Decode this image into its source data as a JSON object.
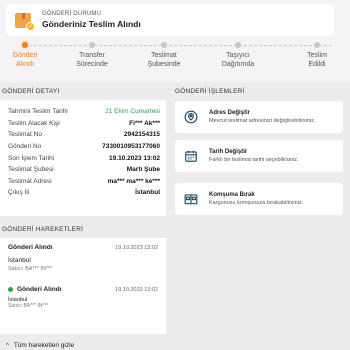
{
  "status": {
    "kicker": "GÖNDERİ DURUMU",
    "title": "Gönderiniz Teslim Alındı",
    "icon": "package-check-icon"
  },
  "steps": [
    {
      "label": "Gönderi\nAlındı",
      "active": true
    },
    {
      "label": "Transfer\nSürecinde",
      "active": false
    },
    {
      "label": "Teslimat\nŞubesinde",
      "active": false
    },
    {
      "label": "Taşıyıcı\nDağıtımda",
      "active": false
    },
    {
      "label": "Teslim\nEdildi",
      "active": false
    }
  ],
  "sections": {
    "detail": "GÖNDERİ DETAYI",
    "operations": "GÖNDERİ İŞLEMLERİ",
    "movements": "GÖNDERİ HAREKETLERİ"
  },
  "details": [
    {
      "key": "Tahmini Teslim Tarihi",
      "value": "21 Ekim Cumartesi"
    },
    {
      "key": "Teslim Alacak Kişi",
      "value": "Fi*** Ak***"
    },
    {
      "key": "Teslimat No",
      "value": "2942154315"
    },
    {
      "key": "Gönderi No",
      "value": "7330010953177060"
    },
    {
      "key": "Son İşlem Tarihi",
      "value": "19.10.2023 13:02"
    },
    {
      "key": "Teslimat Şubesi",
      "value": "Martı Şube"
    },
    {
      "key": "Teslimat Adresi",
      "value": "ma*** ma*** ke***"
    },
    {
      "key": "Çıkış İli",
      "value": "İstanbul"
    }
  ],
  "operations": [
    {
      "title": "Adres Değiştir",
      "subtitle": "Mevcut teslimat adresinizi değiştirebilirsiniz.",
      "icon": "location-pin-icon"
    },
    {
      "title": "Tarih Değiştir",
      "subtitle": "Farklı bir teslimat tarihi seçebilirsiniz.",
      "icon": "calendar-icon"
    },
    {
      "title": "Komşuma Bırak",
      "subtitle": "Kargonuzu komşunuza bırakabilirsiniz.",
      "icon": "neighbor-doors-icon"
    }
  ],
  "movements": [
    {
      "title": "Gönderi Alındı",
      "date": "19.10.2023 13:02",
      "place": "İstanbul",
      "sub": "Satıcı: BA*** İN***"
    },
    {
      "title": "Gönderi Alındı",
      "date": "19.10.2023 13:02",
      "place": "İstanbul",
      "sub": "Satıcı: BA*** İN***"
    }
  ],
  "show_all": "Tüm hareketleri gizle",
  "colors": {
    "accent": "#f27a1a",
    "success": "#2e9e4a",
    "icon": "#1f4e6b"
  }
}
